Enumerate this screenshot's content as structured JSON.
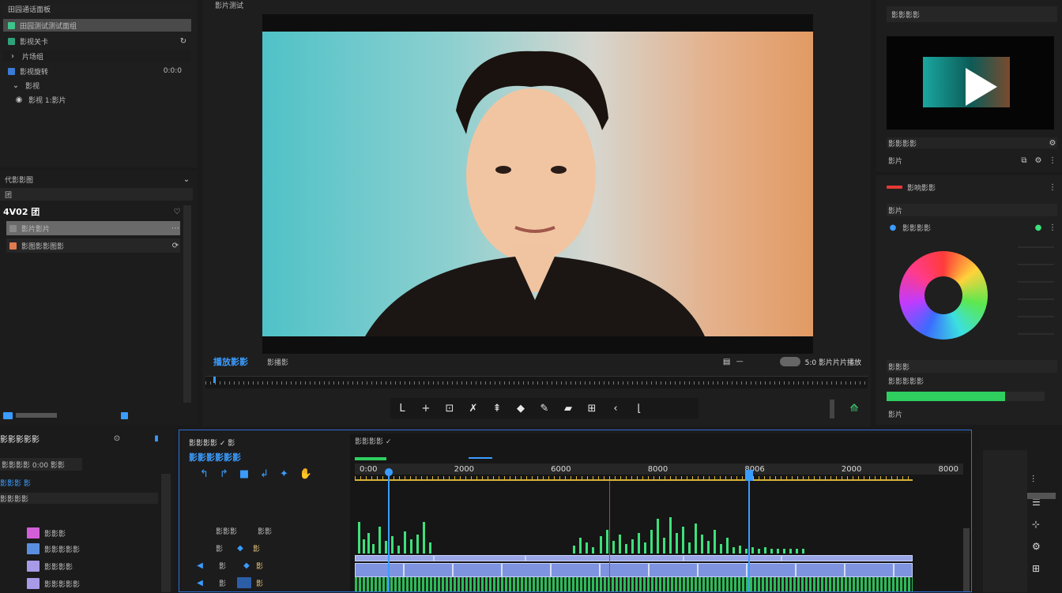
{
  "top_left_tabs": [
    "田园通话面板"
  ],
  "project_panel": {
    "items": [
      {
        "label": "田园测试测试面组",
        "selected": true
      },
      {
        "label": "影视关卡"
      },
      {
        "label": "片场组"
      },
      {
        "label": "影视旋转",
        "value": "0:0:0"
      },
      {
        "label": "影视"
      },
      {
        "label": "影视 1:影片"
      }
    ]
  },
  "media_panel": {
    "title": "代影影图",
    "header_tab": "团",
    "bin_label": "4V02 团",
    "items": [
      {
        "label": "影片影片",
        "selected": true
      },
      {
        "label": "影图影影图影"
      }
    ]
  },
  "viewer": {
    "title": "影片测试",
    "timecode_label": "播放影影",
    "tab2": "影播影",
    "right_label": "5:0 影片片片播放",
    "transport_icons": [
      "mark-in",
      "add",
      "insert",
      "trim",
      "lift",
      "ripple",
      "extract",
      "overwrite",
      "trim-edit",
      "prev",
      "mark-out"
    ]
  },
  "program_panel": {
    "title": "影影影影",
    "caption": "影影影影",
    "subtitle": "影片"
  },
  "color_panel": {
    "title": "影响影影",
    "group": "影片",
    "effect": "影影影影",
    "mix_label": "影影影",
    "mix_value_label": "影影影影影",
    "footer": "影片",
    "mix_percent": 0.75
  },
  "bottom_left": {
    "title": "影影影影影",
    "field": "影影影影 0:00 影影",
    "subtitle": "影影影 影",
    "sub2": "影影影影",
    "tracks": [
      {
        "label": "影影影",
        "color": "#d35fd8"
      },
      {
        "label": "影影影影影",
        "color": "#5a8fe0"
      },
      {
        "label": "影影影影",
        "color": "#a99ae8"
      },
      {
        "label": "影影影影影",
        "color": "#a99ae8"
      }
    ]
  },
  "timeline": {
    "header": "影影影影 ✓ 影",
    "title": "影影影影影影",
    "tab": "影影影影 ✓",
    "timecodes": [
      "0:00",
      "2000",
      "6000",
      "8000",
      "8006",
      "2000",
      "8000"
    ],
    "track_labels": [
      "影影影",
      "影",
      "影",
      "影"
    ],
    "track_values": [
      "影影",
      "影",
      "影",
      "影"
    ]
  }
}
